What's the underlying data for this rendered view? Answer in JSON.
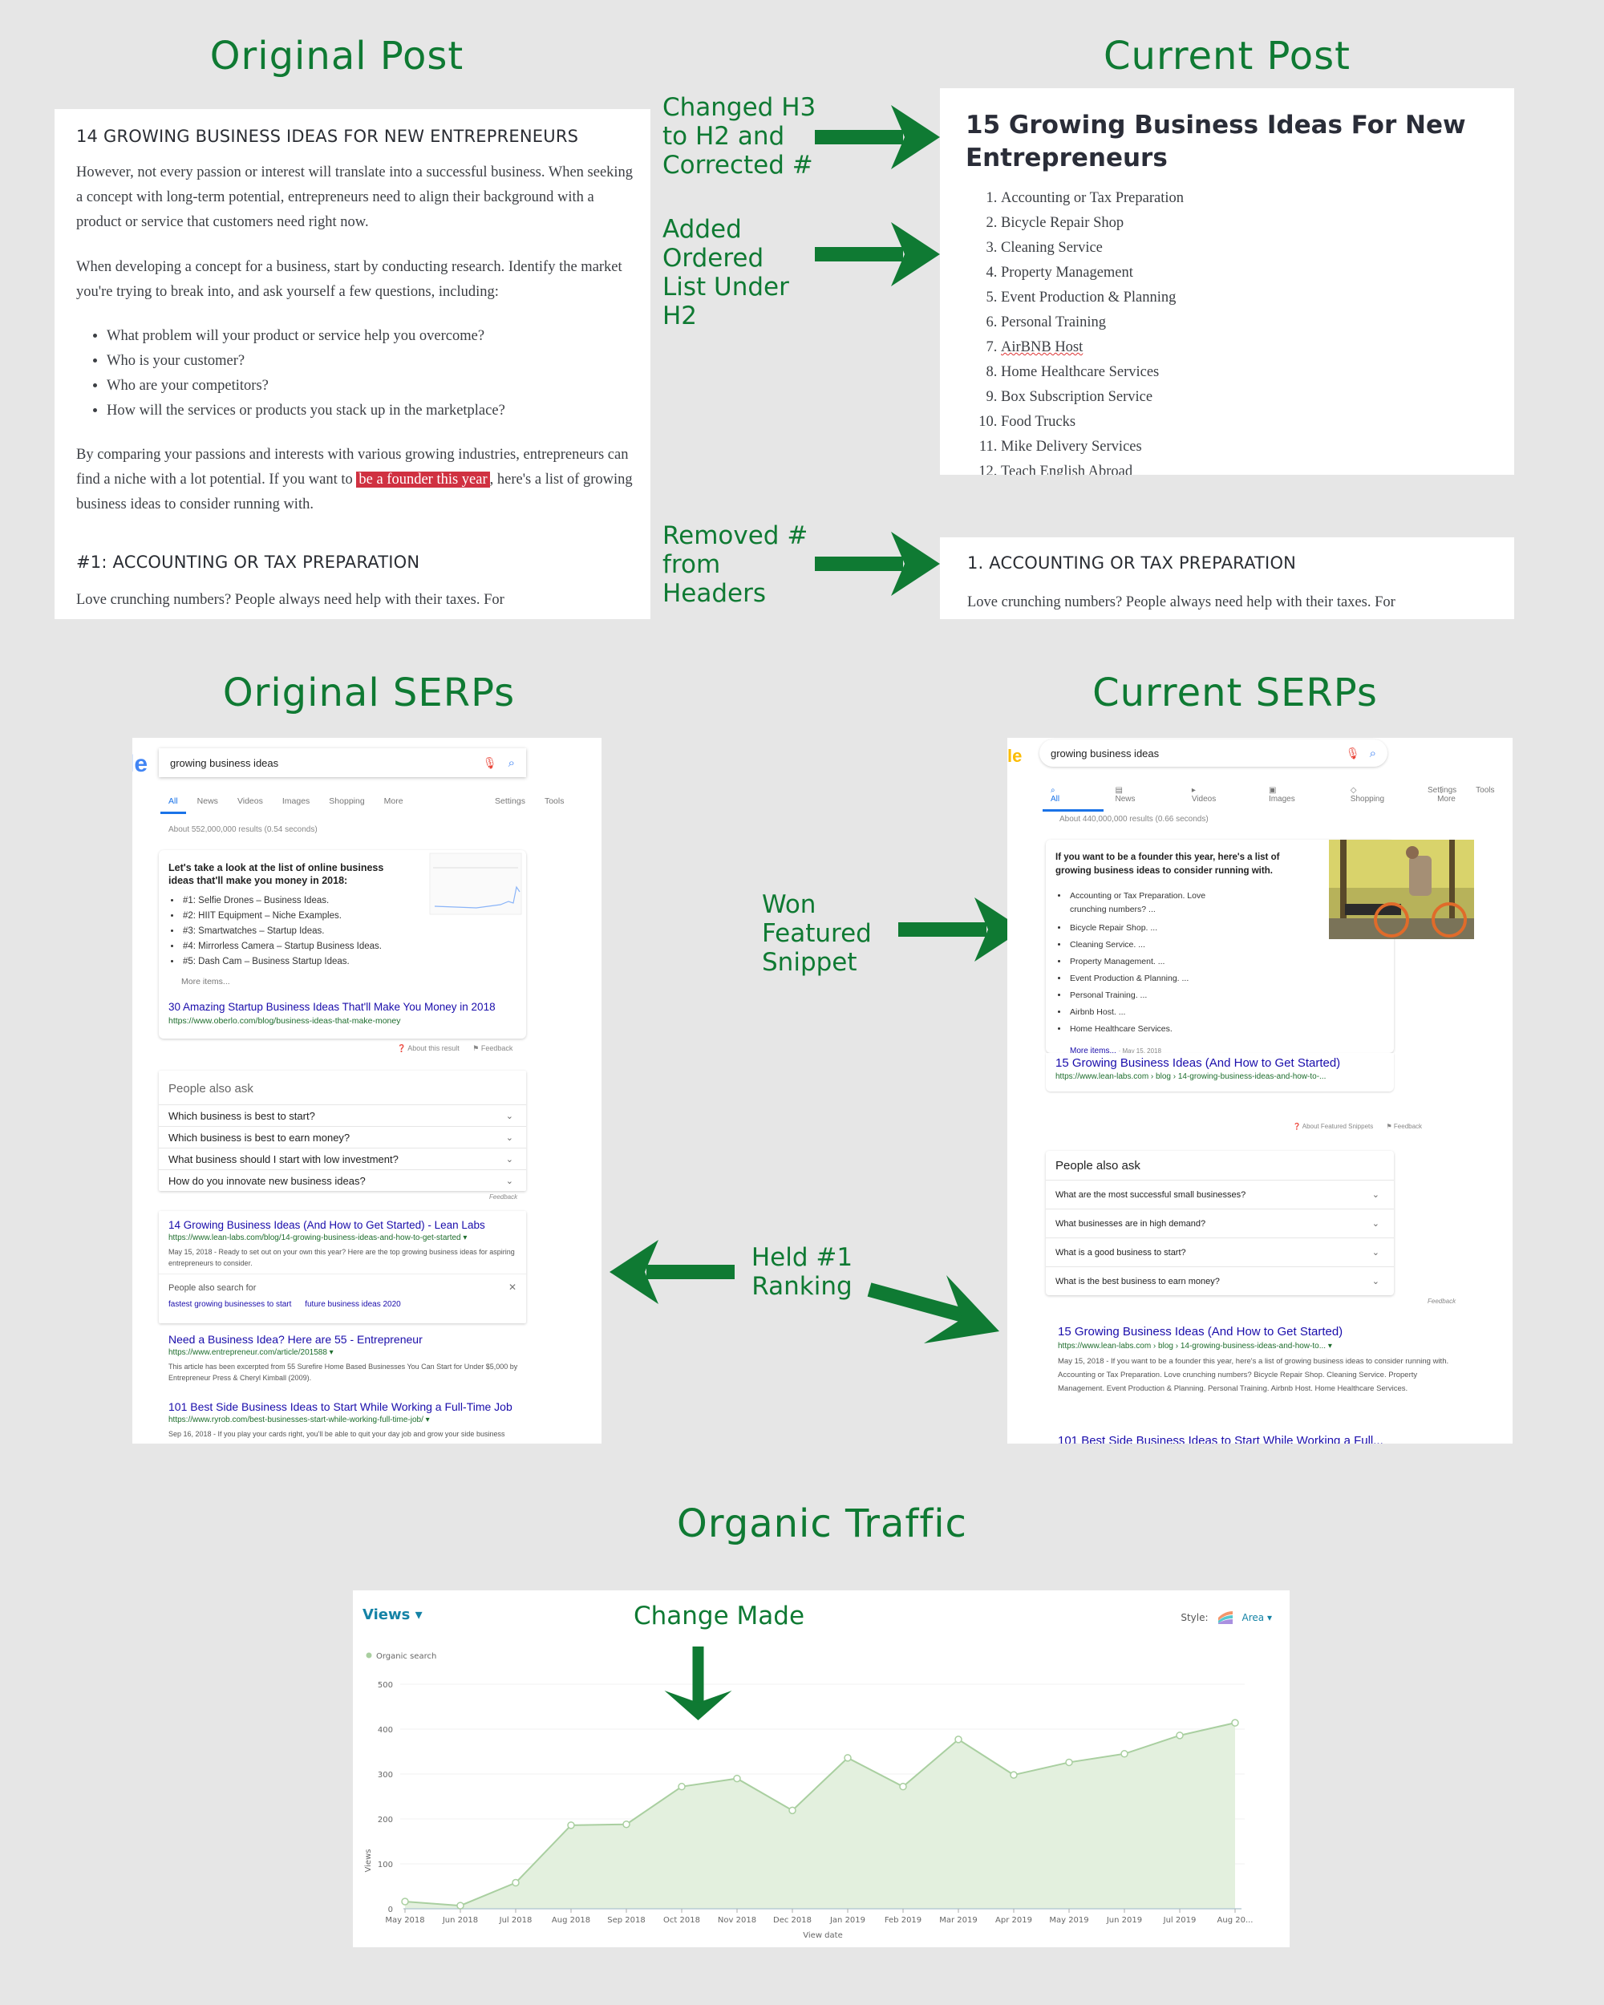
{
  "sections": {
    "original_post_title": "Original Post",
    "current_post_title": "Current Post",
    "original_serps_title": "Original SERPs",
    "current_serps_title": "Current SERPs",
    "organic_traffic_title": "Organic Traffic"
  },
  "annotations": {
    "changed_h3": "Changed H3 to H2 and Corrected #",
    "added_list": "Added Ordered List Under H2",
    "removed_num": "Removed # from Headers",
    "won_snippet": "Won Featured Snippet",
    "held_rank": "Held #1 Ranking",
    "change_made": "Change Made"
  },
  "original_post": {
    "heading": "14 GROWING BUSINESS IDEAS FOR NEW ENTREPRENEURS",
    "para1": "However, not every passion or interest will translate into a successful business. When seeking a concept with long-term potential, entrepreneurs need to align their background with a product or service that customers need right now.",
    "para2": "When developing a concept for a business, start by conducting research. Identify the market you're trying to break into, and ask yourself a few questions, including:",
    "bullets": [
      "What problem will your product or service help you overcome?",
      "Who is your customer?",
      "Who are your competitors?",
      "How will the services or products you stack up in the marketplace?"
    ],
    "para3_before": "By comparing your passions and interests with various growing industries, entrepreneurs can find a niche with a lot potential. If you want to ",
    "para3_highlight": "be a founder this year",
    "para3_after": ", here's a list of growing business ideas to consider running with.",
    "section_heading": "#1: ACCOUNTING OR TAX PREPARATION",
    "section_text": "Love crunching numbers? People always need help with their taxes. For"
  },
  "current_post": {
    "heading": "15 Growing Business Ideas For New Entrepreneurs",
    "list": [
      "Accounting or Tax Preparation",
      "Bicycle Repair Shop",
      "Cleaning Service",
      "Property Management",
      "Event Production & Planning",
      "Personal Training",
      "AirBNB Host",
      "Home Healthcare Services",
      "Box Subscription Service",
      "Food Trucks",
      "Mike Delivery Services",
      "Teach English Abroad"
    ],
    "section_heading": "1. ACCOUNTING OR TAX PREPARATION",
    "section_text": "Love crunching numbers? People always need help with their taxes. For"
  },
  "original_serp": {
    "logo_fragment": "le",
    "query": "growing business ideas",
    "tabs": [
      "All",
      "News",
      "Videos",
      "Images",
      "Shopping",
      "More"
    ],
    "settings": "Settings",
    "tools": "Tools",
    "stats": "About 552,000,000 results (0.54 seconds)",
    "snippet_heading": "Let's take a look at the list of online business ideas that'll make you money in 2018:",
    "snippet_items": [
      "#1: Selfie Drones – Business Ideas.",
      "#2: HIIT Equipment – Niche Examples.",
      "#3: Smartwatches – Startup Ideas.",
      "#4: Mirrorless Camera – Startup Business Ideas.",
      "#5: Dash Cam – Business Startup Ideas."
    ],
    "more_items": "More items...",
    "snippet_link": "30 Amazing Startup Business Ideas That'll Make You Money in 2018",
    "snippet_url": "https://www.oberlo.com/blog/business-ideas-that-make-money",
    "about_result": "About this result",
    "feedback": "Feedback",
    "paa_title": "People also ask",
    "paa": [
      "Which business is best to start?",
      "Which business is best to earn money?",
      "What business should I start with low investment?",
      "How do you innovate new business ideas?"
    ],
    "paa_feedback": "Feedback",
    "result1": {
      "title": "14 Growing Business Ideas (And How to Get Started) - Lean Labs",
      "url": "https://www.lean-labs.com/blog/14-growing-business-ideas-and-how-to-get-started ▾",
      "snippet": "May 15, 2018 - Ready to set out on your own this year? Here are the top growing business ideas for aspiring entrepreneurs to consider."
    },
    "pasf_title": "People also search for",
    "pasf": [
      "fastest growing businesses to start",
      "future business ideas 2020"
    ],
    "result2": {
      "title": "Need a Business Idea? Here are 55 - Entrepreneur",
      "url": "https://www.entrepreneur.com/article/201588 ▾",
      "snippet": "This article has been excerpted from 55 Surefire Home Based Businesses You Can Start for Under $5,000 by Entrepreneur Press & Cheryl Kimball (2009)."
    },
    "result3": {
      "title": "101 Best Side Business Ideas to Start While Working a Full-Time Job",
      "url": "https://www.ryrob.com/best-businesses-start-while-working-full-time-job/ ▾",
      "snippet": "Sep 16, 2018 - If you play your cards right, you'll be able to quit your day job and grow your side business"
    }
  },
  "current_serp": {
    "logo_fragment": "le",
    "query": "growing business ideas",
    "tabs": [
      "All",
      "News",
      "Videos",
      "Images",
      "Shopping",
      "More"
    ],
    "settings": "Settings",
    "tools": "Tools",
    "stats": "About 440,000,000 results (0.66 seconds)",
    "snippet_heading": "If you want to be a founder this year, here's a list of growing business ideas to consider running with.",
    "snippet_items": [
      "Accounting or Tax Preparation. Love crunching numbers? ...",
      "Bicycle Repair Shop. ...",
      "Cleaning Service. ...",
      "Property Management. ...",
      "Event Production & Planning. ...",
      "Personal Training. ...",
      "Airbnb Host. ...",
      "Home Healthcare Services."
    ],
    "more_items": "More items...",
    "more_date": "· May 15, 2018",
    "snippet_link": "15 Growing Business Ideas (And How to Get Started)",
    "snippet_url": "https://www.lean-labs.com › blog › 14-growing-business-ideas-and-how-to-...",
    "about_snippets": "About Featured Snippets",
    "feedback": "Feedback",
    "paa_title": "People also ask",
    "paa": [
      "What are the most successful small businesses?",
      "What businesses are in high demand?",
      "What is a good business to start?",
      "What is the best business to earn money?"
    ],
    "paa_feedback": "Feedback",
    "result1": {
      "title": "15 Growing Business Ideas (And How to Get Started)",
      "url": "https://www.lean-labs.com › blog › 14-growing-business-ideas-and-how-to... ▾",
      "snippet": "May 15, 2018 - If you want to be a founder this year, here's a list of growing business ideas to consider running with. Accounting or Tax Preparation. Love crunching numbers? Bicycle Repair Shop. Cleaning Service. Property Management. Event Production & Planning. Personal Training. Airbnb Host. Home Healthcare Services."
    },
    "result2_title": "101 Best Side Business Ideas to Start While Working a Full..."
  },
  "chart_header": {
    "metric": "Views ▾",
    "style_label": "Style:",
    "style_value": "Area ▾"
  },
  "colors": {
    "accent_green": "#0f7a33",
    "series_fill": "#e3f0de",
    "series_line": "#a9cfa0",
    "highlight_red": "#d03141"
  },
  "chart_data": {
    "type": "area",
    "title": "",
    "legend": [
      "Organic search"
    ],
    "legend_position": "top-left",
    "xlabel": "View date",
    "ylabel": "Views",
    "ylim": [
      0,
      500
    ],
    "yticks": [
      0,
      100,
      200,
      300,
      400,
      500
    ],
    "grid": true,
    "categories": [
      "May 2018",
      "Jun 2018",
      "Jul 2018",
      "Aug 2018",
      "Sep 2018",
      "Oct 2018",
      "Nov 2018",
      "Dec 2018",
      "Jan 2019",
      "Feb 2019",
      "Mar 2019",
      "Apr 2019",
      "May 2019",
      "Jun 2019",
      "Jul 2019",
      "Aug 20..."
    ],
    "series": [
      {
        "name": "Organic search",
        "values": [
          16,
          7,
          58,
          186,
          188,
          272,
          290,
          219,
          336,
          272,
          377,
          298,
          326,
          345,
          386,
          414
        ]
      }
    ],
    "annotation": {
      "label": "Change Made",
      "at_category": "Oct 2018"
    }
  }
}
